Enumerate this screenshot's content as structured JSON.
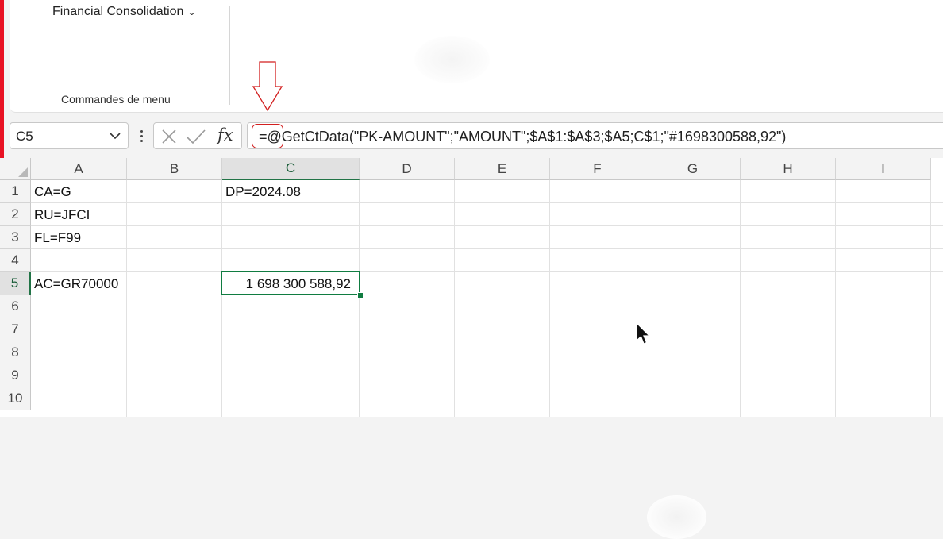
{
  "ribbon": {
    "addin_button": "Financial Consolidation",
    "group_label": "Commandes de menu"
  },
  "formula_bar": {
    "name_box": "C5",
    "formula_prefix": "=@",
    "formula_rest": "GetCtData(\"PK-AMOUNT\";\"AMOUNT\";$A$1:$A$3;$A5;C$1;\"#1698300588,92\")",
    "fx_label": "fx"
  },
  "colors": {
    "accent_green": "#217346",
    "annotation_red": "#d21f1f",
    "edge_red": "#e81123"
  },
  "grid": {
    "columns": [
      "A",
      "B",
      "C",
      "D",
      "E",
      "F",
      "G",
      "H",
      "I"
    ],
    "rows": [
      "1",
      "2",
      "3",
      "4",
      "5",
      "6",
      "7",
      "8",
      "9",
      "10"
    ],
    "selected_column": "C",
    "selected_row": "5",
    "cells": {
      "A1": "CA=G",
      "A2": "RU=JFCI",
      "A3": "FL=F99",
      "A5": "AC=GR70000",
      "C1": "DP=2024.08",
      "C5": "1 698 300 588,92"
    }
  },
  "icons": [
    "chevron-down-icon",
    "more-options-icon",
    "cancel-icon",
    "enter-icon",
    "insert-function-icon",
    "annotation-arrow-icon",
    "mouse-cursor-icon"
  ]
}
